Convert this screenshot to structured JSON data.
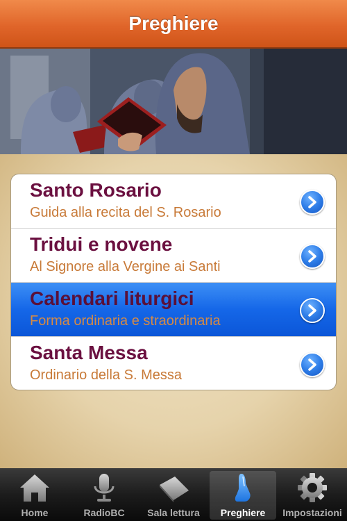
{
  "navbar": {
    "title": "Preghiere"
  },
  "menu": {
    "items": [
      {
        "title": "Santo Rosario",
        "subtitle": "Guida alla recita del S. Rosario"
      },
      {
        "title": "Tridui e novene",
        "subtitle": "Al Signore alla Vergine ai Santi"
      },
      {
        "title": "Calendari liturgici",
        "subtitle": "Forma ordinaria e straordinaria",
        "selected": true
      },
      {
        "title": "Santa Messa",
        "subtitle": "Ordinario della S. Messa"
      }
    ]
  },
  "tabbar": {
    "tabs": [
      {
        "label": "Home",
        "icon": "home-icon"
      },
      {
        "label": "RadioBC",
        "icon": "microphone-icon"
      },
      {
        "label": "Sala lettura",
        "icon": "book-icon"
      },
      {
        "label": "Preghiere",
        "icon": "praying-hands-icon",
        "active": true
      },
      {
        "label": "Impostazioni",
        "icon": "gear-icon"
      }
    ]
  },
  "colors": {
    "navbar": "#e0652a",
    "title_text": "#6b1040",
    "subtitle_text": "#c87a38",
    "selection": "#1567e8",
    "tab_active_icon": "#3a9bff"
  }
}
